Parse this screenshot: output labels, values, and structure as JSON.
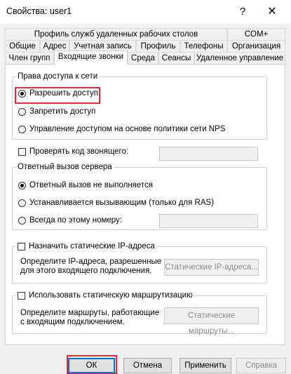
{
  "window": {
    "title": "Свойства: user1",
    "help_glyph": "?",
    "close_glyph": "✕"
  },
  "tabs": {
    "row1": [
      "Профиль служб удаленных рабочих столов",
      "COM+"
    ],
    "row2": [
      "Общие",
      "Адрес",
      "Учетная запись",
      "Профиль",
      "Телефоны",
      "Организация"
    ],
    "row3": [
      "Член групп",
      "Входящие звонки",
      "Среда",
      "Сеансы",
      "Удаленное управление"
    ],
    "active": "Входящие звонки"
  },
  "network_access": {
    "legend": "Права доступа к сети",
    "options": [
      {
        "label": "Разрешить доступ",
        "checked": true
      },
      {
        "label": "Запретить доступ",
        "checked": false
      },
      {
        "label": "Управление доступом на основе политики сети NPS",
        "checked": false
      }
    ]
  },
  "verify_caller": {
    "label": "Проверять код звонящего:",
    "checked": false,
    "value": ""
  },
  "callback": {
    "legend": "Ответный вызов сервера",
    "options": [
      {
        "label": "Ответный вызов не выполняется",
        "checked": true
      },
      {
        "label": "Устанавливается вызывающим (только для RAS)",
        "checked": false
      },
      {
        "label": "Всегда по этому номеру:",
        "checked": false
      }
    ],
    "number_value": ""
  },
  "static_ip": {
    "legend": "Назначить статические IP-адреса",
    "checked": false,
    "desc_line1": "Определите IP-адреса, разрешенные",
    "desc_line2": "для этого входящего подключения.",
    "button": "Статические IP-адреса..."
  },
  "static_routing": {
    "legend": "Использовать статическую маршрутизацию",
    "checked": false,
    "desc_line1": "Определите маршруты, работающие",
    "desc_line2": "с входящим подключением.",
    "button": "Статические маршруты..."
  },
  "footer": {
    "ok": "ОК",
    "cancel": "Отмена",
    "apply": "Применить",
    "help": "Справка"
  },
  "colors": {
    "highlight": "#e8283c",
    "default_button_border": "#0078d7"
  }
}
